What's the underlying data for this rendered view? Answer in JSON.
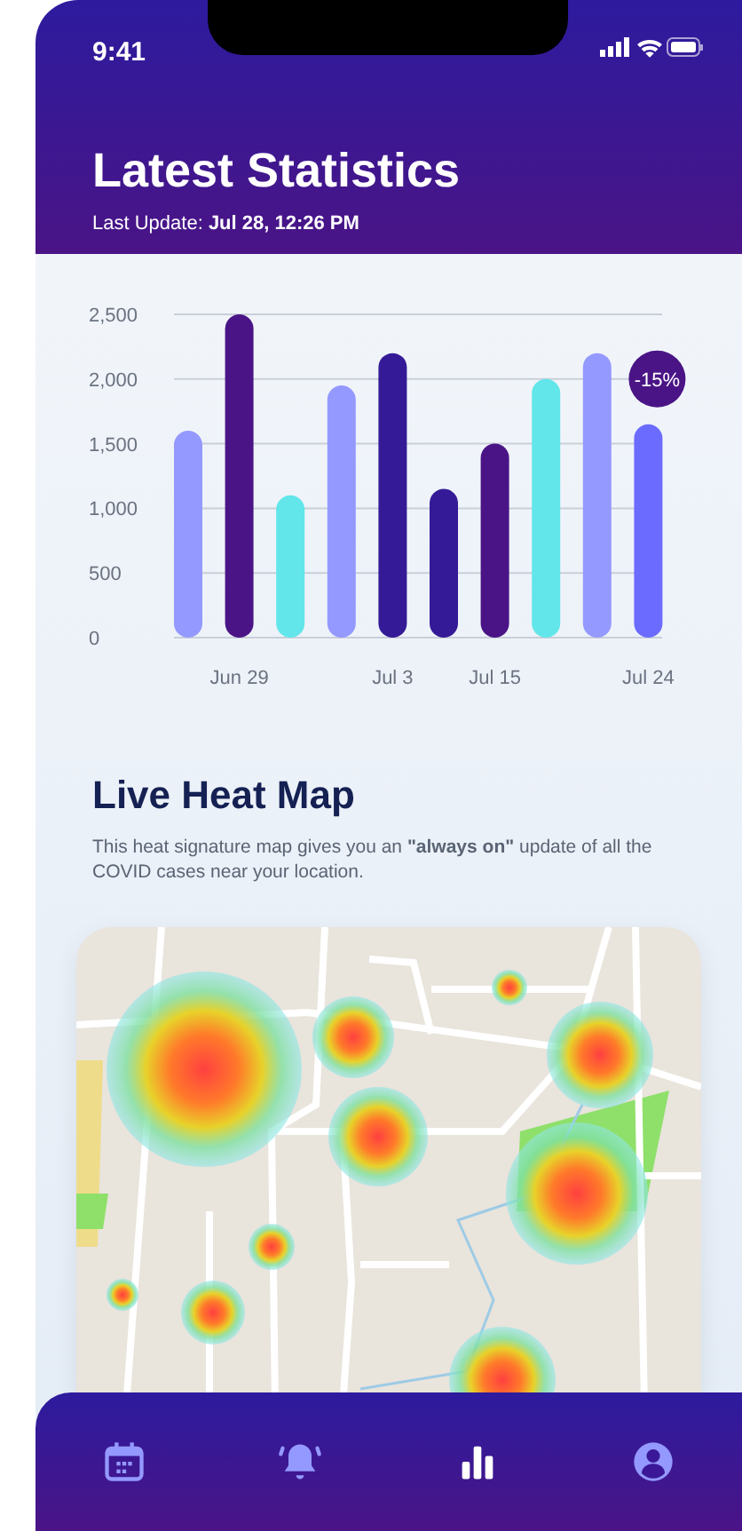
{
  "status_bar": {
    "time": "9:41"
  },
  "header": {
    "title": "Latest Statistics",
    "last_update": "Last Update: **Jul 28, 12:26 PM**"
  },
  "chart_data": {
    "type": "bar",
    "ylim": [
      0,
      2500
    ],
    "yticks": [
      {
        "value": 0,
        "label": "0"
      },
      {
        "value": 500,
        "label": "500"
      },
      {
        "value": 1000,
        "label": "1,000"
      },
      {
        "value": 1500,
        "label": "1,500"
      },
      {
        "value": 2000,
        "label": "2,000"
      },
      {
        "value": 2500,
        "label": "2,500"
      }
    ],
    "grid": true,
    "categories": [
      null,
      "Jun 29",
      null,
      null,
      "Jul 3",
      null,
      "Jul 15",
      null,
      null,
      "Jul 24"
    ],
    "series": [
      {
        "color": "#9499ff",
        "colors": [
          null,
          "#4a1486",
          "#62e6ea",
          null,
          "#341a96",
          "#341a96",
          "#4a1486",
          "#62e6ea",
          null,
          "#6b6bff"
        ],
        "values": [
          1600,
          2500,
          1100,
          1950,
          2200,
          1150,
          1500,
          2000,
          2200,
          1650
        ]
      }
    ],
    "annotations": [
      "-15%"
    ]
  },
  "heat_map": {
    "title": "Live Heat Map",
    "description": "This heat signature map gives you an **\"always on\"** update of all the COVID cases near your location."
  },
  "tab_bar": [
    {
      "kind": "calendar",
      "selected": false
    },
    {
      "kind": "bell",
      "selected": false
    },
    {
      "kind": "chart",
      "selected": true
    },
    {
      "kind": "profile",
      "selected": false
    }
  ]
}
